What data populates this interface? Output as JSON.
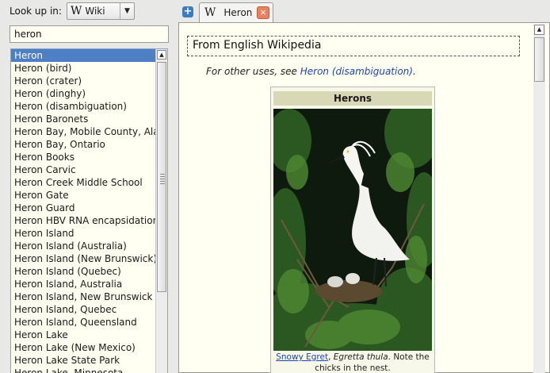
{
  "lookup": {
    "label": "Look up in:",
    "dictionary": "Wiki",
    "dict_icon": "W"
  },
  "search": {
    "value": "heron"
  },
  "word_list": [
    "Heron",
    "Heron (bird)",
    "Heron (crater)",
    "Heron (dinghy)",
    "Heron (disambiguation)",
    "Heron Baronets",
    "Heron Bay, Mobile County, Alabama",
    "Heron Bay, Ontario",
    "Heron Books",
    "Heron Carvic",
    "Heron Creek Middle School",
    "Heron Gate",
    "Heron Guard",
    "Heron HBV RNA encapsidation signal",
    "Heron Island",
    "Heron Island (Australia)",
    "Heron Island (New Brunswick)",
    "Heron Island (Quebec)",
    "Heron Island, Australia",
    "Heron Island, New Brunswick",
    "Heron Island, Quebec",
    "Heron Island, Queensland",
    "Heron Lake",
    "Heron Lake (New Mexico)",
    "Heron Lake State Park",
    "Heron Lake, Minnesota"
  ],
  "selected_index": 0,
  "tab": {
    "label": "Heron",
    "icon": "W",
    "close": "×",
    "new": "+"
  },
  "article": {
    "dict_header": "From English Wikipedia",
    "hatnote_prefix": "For other uses, see ",
    "hatnote_link": "Heron (disambiguation)",
    "hatnote_suffix": ".",
    "infobox_title": "Herons",
    "caption_link": "Snowy Egret",
    "caption_sep": ", ",
    "caption_species": "Egretta thula",
    "caption_rest": ". Note the chicks in the nest."
  },
  "colors": {
    "selection": "#4e7fc4",
    "paper": "#fffff2",
    "link": "#1a46b8",
    "close_button": "#e8815d"
  }
}
